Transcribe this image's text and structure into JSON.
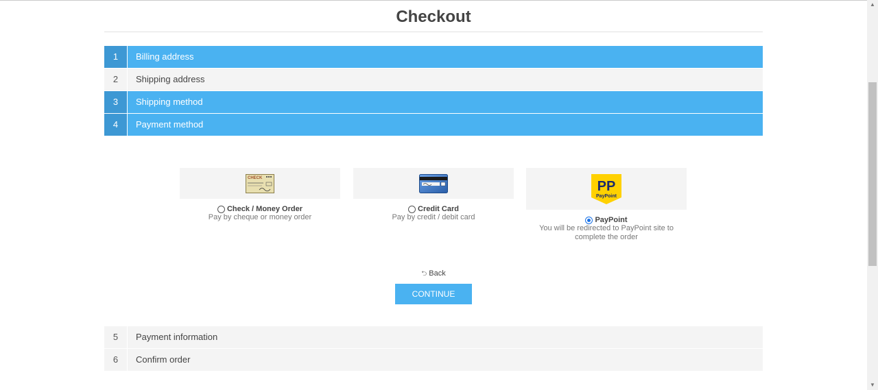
{
  "page": {
    "title": "Checkout"
  },
  "steps_top": [
    {
      "num": "1",
      "label": "Billing address",
      "active": true
    },
    {
      "num": "2",
      "label": "Shipping address",
      "active": false
    },
    {
      "num": "3",
      "label": "Shipping method",
      "active": true
    },
    {
      "num": "4",
      "label": "Payment method",
      "active": true
    }
  ],
  "payment_methods": [
    {
      "name": "Check / Money Order",
      "description": "Pay by cheque or money order",
      "selected": false,
      "icon": "check-image"
    },
    {
      "name": "Credit Card",
      "description": "Pay by credit / debit card",
      "selected": false,
      "icon": "credit-card-image"
    },
    {
      "name": "PayPoint",
      "description": "You will be redirected to PayPoint site to complete the order",
      "selected": true,
      "icon": "paypoint-logo"
    }
  ],
  "actions": {
    "back_label": "Back",
    "continue_label": "Continue"
  },
  "steps_bottom": [
    {
      "num": "5",
      "label": "Payment information",
      "active": false
    },
    {
      "num": "6",
      "label": "Confirm order",
      "active": false
    }
  ],
  "colors": {
    "accent": "#4ab2f1",
    "accent_dark": "#3d98d4",
    "paypoint_yellow": "#ffd100",
    "paypoint_navy": "#1b2a6b"
  }
}
